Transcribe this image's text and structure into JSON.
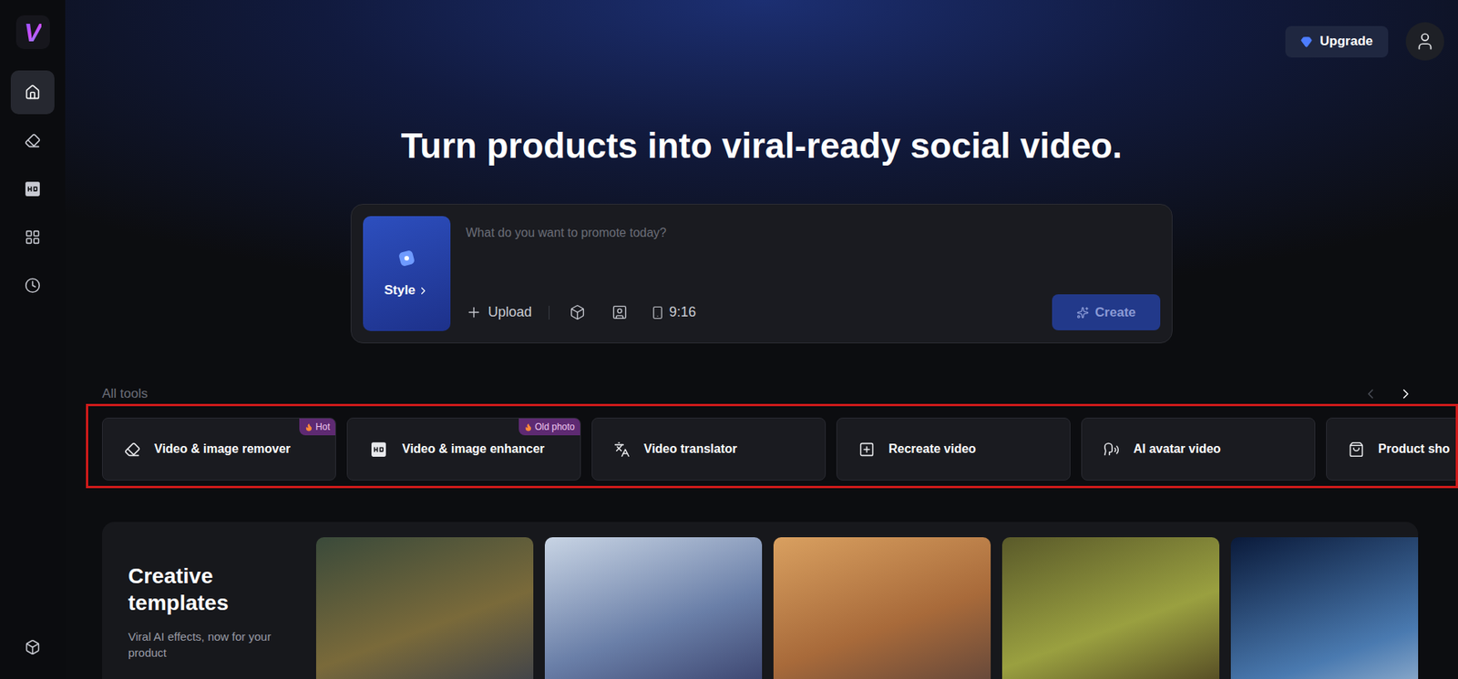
{
  "sidebar": {
    "logo": "V",
    "items": [
      {
        "kind": "home",
        "selected": true
      },
      {
        "kind": "eraser",
        "selected": false
      },
      {
        "kind": "hd",
        "selected": false
      },
      {
        "kind": "grid",
        "selected": false
      },
      {
        "kind": "history",
        "selected": false
      }
    ],
    "bottom": {
      "kind": "box"
    }
  },
  "header": {
    "upgrade": "Upgrade"
  },
  "hero": {
    "title": "Turn products into viral-ready social video."
  },
  "prompt": {
    "style": "Style",
    "placeholder": "What do you want to promote today?",
    "upload": "Upload",
    "ratio": "9:16",
    "create": "Create",
    "create_disabled": true
  },
  "tools": {
    "label": "All tools",
    "prev_disabled": true,
    "next_disabled": false,
    "highlighted": true,
    "items": [
      {
        "kind": "eraser",
        "label": "Video & image remover",
        "badge": "Hot"
      },
      {
        "kind": "hd",
        "label": "Video & image enhancer",
        "badge": "Old photo"
      },
      {
        "kind": "translate",
        "label": "Video translator",
        "badge": ""
      },
      {
        "kind": "recreate",
        "label": "Recreate video",
        "badge": ""
      },
      {
        "kind": "avatar",
        "label": "AI avatar video",
        "badge": ""
      },
      {
        "kind": "product",
        "label": "Product sho",
        "badge": ""
      }
    ]
  },
  "templates": {
    "title": "Creative templates",
    "subtitle": "Viral AI effects, now for your product",
    "cards": [
      {
        "kind": "photo"
      },
      {
        "kind": "photo"
      },
      {
        "kind": "photo"
      },
      {
        "kind": "photo"
      },
      {
        "kind": "photo"
      }
    ]
  }
}
